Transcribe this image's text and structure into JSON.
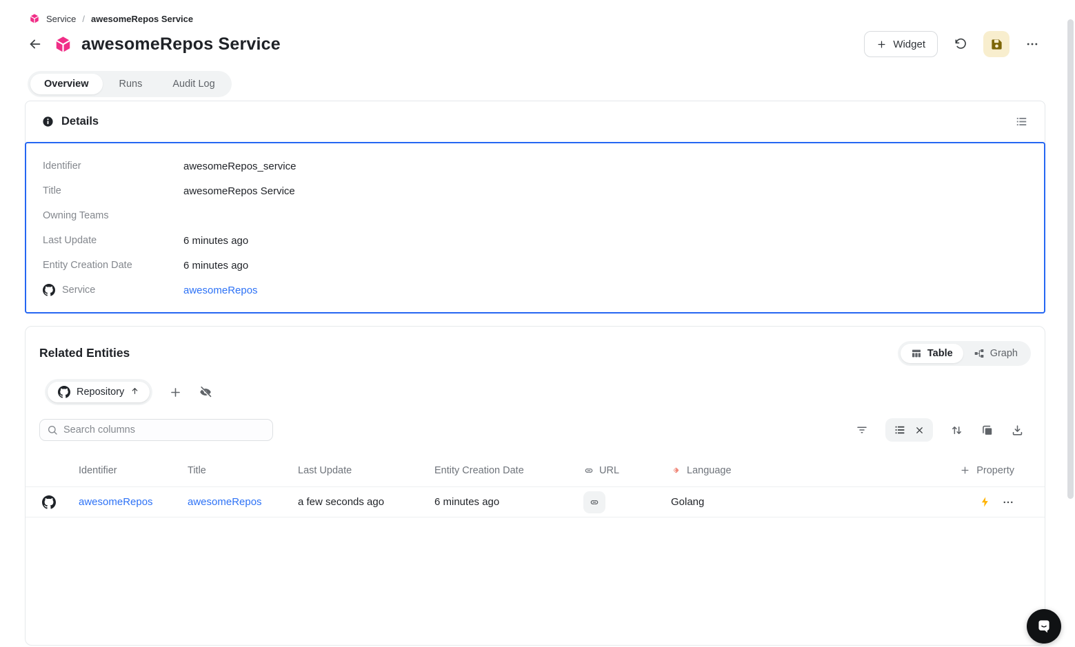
{
  "app": {
    "breadcrumb": {
      "root": "Service",
      "separator": "/",
      "current": "awesomeRepos Service"
    },
    "page_title": "awesomeRepos Service",
    "toolbar": {
      "widget_label": "Widget"
    }
  },
  "tabs": [
    {
      "label": "Overview",
      "active": true
    },
    {
      "label": "Runs",
      "active": false
    },
    {
      "label": "Audit Log",
      "active": false
    }
  ],
  "details": {
    "title": "Details",
    "rows": [
      {
        "label": "Identifier",
        "value": "awesomeRepos_service"
      },
      {
        "label": "Title",
        "value": "awesomeRepos Service"
      },
      {
        "label": "Owning Teams",
        "value": ""
      },
      {
        "label": "Last Update",
        "value": "6 minutes ago"
      },
      {
        "label": "Entity Creation Date",
        "value": "6 minutes ago"
      },
      {
        "label": "Service",
        "value": "awesomeRepos"
      }
    ]
  },
  "related": {
    "title": "Related Entities",
    "view_toggle": {
      "table": "Table",
      "graph": "Graph"
    },
    "relation_filter": {
      "label": "Repository"
    },
    "search": {
      "placeholder": "Search columns"
    },
    "table": {
      "columns": {
        "identifier": "Identifier",
        "title": "Title",
        "last_update": "Last Update",
        "entity_creation_date": "Entity Creation Date",
        "url": "URL",
        "language": "Language",
        "add_property": "Property"
      },
      "rows": [
        {
          "identifier": "awesomeRepos",
          "title": "awesomeRepos",
          "last_update": "a few seconds ago",
          "entity_creation_date": "6 minutes ago",
          "language": "Golang"
        }
      ]
    }
  },
  "colors": {
    "brand_pink": "#F02E87",
    "link_blue": "#2D72F6",
    "selection_blue": "#2566F2",
    "save_button_bg": "#F8EECE",
    "save_icon": "#7D6608",
    "lightning": "#FFB300",
    "language_icon": "#F0897B"
  }
}
